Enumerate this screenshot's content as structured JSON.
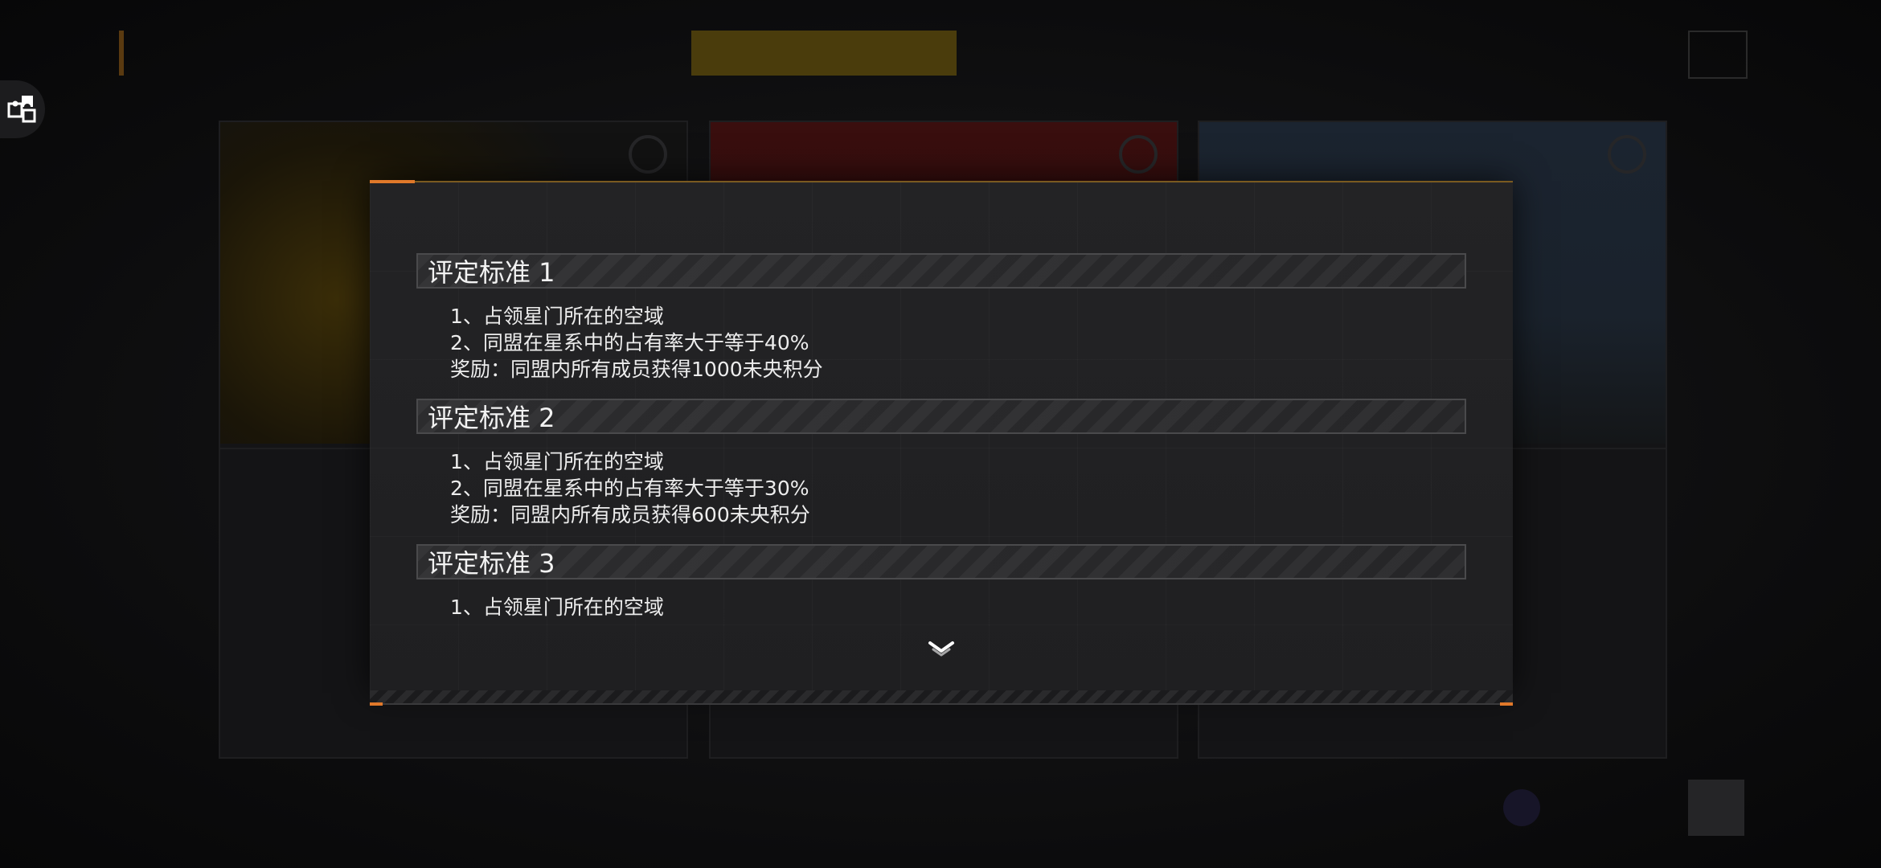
{
  "sections": [
    {
      "title": "评定标准 1",
      "lines": [
        "1、占领星门所在的空域",
        "2、同盟在星系中的占有率大于等于40%",
        "奖励：同盟内所有成员获得1000未央积分"
      ]
    },
    {
      "title": "评定标准 2",
      "lines": [
        "1、占领星门所在的空域",
        "2、同盟在星系中的占有率大于等于30%",
        "奖励：同盟内所有成员获得600未央积分"
      ]
    },
    {
      "title": "评定标准 3",
      "lines": [
        "1、占领星门所在的空域"
      ]
    }
  ],
  "icons": {
    "left_float": "puzzle-icon",
    "scroll": "chevron-down-icon"
  },
  "colors": {
    "accent_orange": "#e0782a",
    "modal_bg": "#222224",
    "text": "#ededed"
  }
}
